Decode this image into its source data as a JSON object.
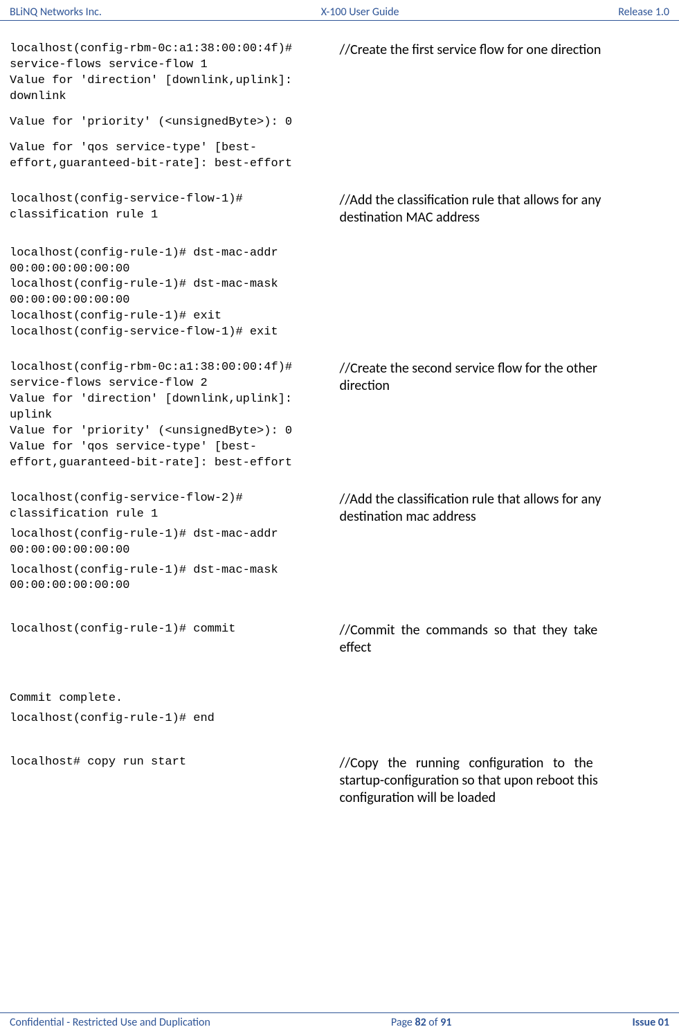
{
  "header": {
    "left": "BLiNQ Networks Inc.",
    "center": "X-100 User Guide",
    "right": "Release 1.0"
  },
  "footer": {
    "left": "Confidential - Restricted Use and Duplication",
    "center_prefix": "Page ",
    "center_page": "82",
    "center_middle": " of ",
    "center_total": "91",
    "right": "Issue 01"
  },
  "blocks": {
    "b1_code_l1": "localhost(config-rbm-0c:a1:38:00:00:4f)#",
    "b1_code_l2": "service-flows service-flow 1",
    "b1_code_l3": "Value for 'direction' [downlink,uplink]:",
    "b1_code_l4": "downlink",
    "b1_code_l5": "Value for 'priority' (<unsignedByte>): 0",
    "b1_code_l6": "Value for 'qos service-type' [best-",
    "b1_code_l7": "effort,guaranteed-bit-rate]: best-effort",
    "b1_comment": "//Create the first service flow for one direction",
    "b2_code_l1": "localhost(config-service-flow-1)#",
    "b2_code_l2": "classification rule 1",
    "b2_comment_l1": "//Add the classification rule that allows for any",
    "b2_comment_l2": "destination MAC address",
    "b3_code_l1": "localhost(config-rule-1)# dst-mac-addr",
    "b3_code_l2": "00:00:00:00:00:00",
    "b3_code_l3": "localhost(config-rule-1)# dst-mac-mask",
    "b3_code_l4": "00:00:00:00:00:00",
    "b3_code_l5": "localhost(config-rule-1)# exit",
    "b3_code_l6": "localhost(config-service-flow-1)# exit",
    "b4_code_l1": "localhost(config-rbm-0c:a1:38:00:00:4f)#",
    "b4_code_l2": "service-flows service-flow 2",
    "b4_code_l3": "Value for 'direction' [downlink,uplink]:",
    "b4_code_l4": "uplink",
    "b4_code_l5": "Value for 'priority' (<unsignedByte>): 0",
    "b4_code_l6": "Value for 'qos service-type' [best-",
    "b4_code_l7": "effort,guaranteed-bit-rate]: best-effort",
    "b4_comment_l1": "//Create the second service flow for the other",
    "b4_comment_l2": "direction",
    "b5_code_l1": "localhost(config-service-flow-2)#",
    "b5_code_l2": "classification rule 1",
    "b5_code_l3": "localhost(config-rule-1)# dst-mac-addr",
    "b5_code_l4": "00:00:00:00:00:00",
    "b5_code_l5": "localhost(config-rule-1)# dst-mac-mask",
    "b5_code_l6": "00:00:00:00:00:00",
    "b5_comment_l1": "//Add the classification rule that allows for any",
    "b5_comment_l2": "destination mac address",
    "b6_code_l1": "localhost(config-rule-1)# commit",
    "b6_comment_l1": "//Commit  the  commands  so  that  they  take",
    "b6_comment_l2": "effect",
    "b7_code_l1": "Commit complete.",
    "b7_code_l2": "localhost(config-rule-1)# end",
    "b8_code_l1": "localhost# copy run start",
    "b8_comment_l1": "//Copy   the   running   configuration   to   the",
    "b8_comment_l2": "startup-configuration so that upon reboot this",
    "b8_comment_l3": "configuration will be loaded"
  }
}
